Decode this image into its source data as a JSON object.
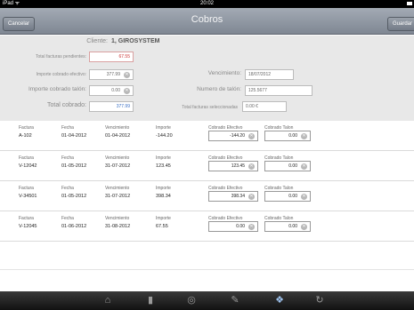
{
  "status_bar": {
    "device": "iPad ᯤ",
    "time": "20:02"
  },
  "nav": {
    "title": "Cobros",
    "left_button": "Cancelar",
    "right_button": "Guardar"
  },
  "summary": {
    "cliente_label": "Cliente:",
    "cliente_value": "1, GIROSYSTEM",
    "total_pendientes_label": "Total facturas pendientes:",
    "total_pendientes_value": "67.55",
    "importe_efectivo_label": "Importe cobrado efectivo:",
    "importe_efectivo_value": "377.99",
    "vencimiento_label": "Vencimiento:",
    "vencimiento_value": "18/07/2012",
    "importe_talon_label": "Importe cobrado talón:",
    "importe_talon_value": "0.00",
    "numero_talon_label": "Numero de talón:",
    "numero_talon_value": "125.5677",
    "total_cobrado_label": "Total cobrado:",
    "total_cobrado_value": "377.99",
    "total_seleccionadas_label": "Total facturas seleccionadas",
    "total_seleccionadas_value": "0.00 €"
  },
  "table": {
    "headers": {
      "factura": "Factura",
      "fecha": "Fecha",
      "vencimiento": "Vencimiento",
      "importe": "Importe",
      "cobrado_efectivo": "Cobrado Efectivo",
      "cobrado_talon": "Cobrado Talon"
    },
    "rows": [
      {
        "factura": "A-102",
        "fecha": "01-04-2012",
        "vencimiento": "01-04-2012",
        "importe": "-144.20",
        "efectivo": "-144.20",
        "talon": "0.00"
      },
      {
        "factura": "V-12042",
        "fecha": "01-05-2012",
        "vencimiento": "31-07-2012",
        "importe": "123.45",
        "efectivo": "123.45",
        "talon": "0.00"
      },
      {
        "factura": "V-34501",
        "fecha": "01-05-2012",
        "vencimiento": "31-07-2012",
        "importe": "398.34",
        "efectivo": "398.34",
        "talon": "0.00"
      },
      {
        "factura": "V-12045",
        "fecha": "01-06-2012",
        "vencimiento": "31-08-2012",
        "importe": "67.55",
        "efectivo": "0.00",
        "talon": "0.00"
      }
    ]
  },
  "clear_glyph": "✕",
  "tab_bar": {
    "tabs": [
      {
        "icon": "home-icon",
        "glyph": "⌂"
      },
      {
        "icon": "book-icon",
        "glyph": "▮"
      },
      {
        "icon": "dashboard-icon",
        "glyph": "◎"
      },
      {
        "icon": "edit-icon",
        "glyph": "✎"
      },
      {
        "icon": "money-icon",
        "glyph": "❖"
      },
      {
        "icon": "refresh-icon",
        "glyph": "↻"
      }
    ],
    "active_index": 4
  },
  "colors": {
    "accent": "#3a6fc4",
    "pending": "#cc3333",
    "nav": "#8a919c"
  }
}
